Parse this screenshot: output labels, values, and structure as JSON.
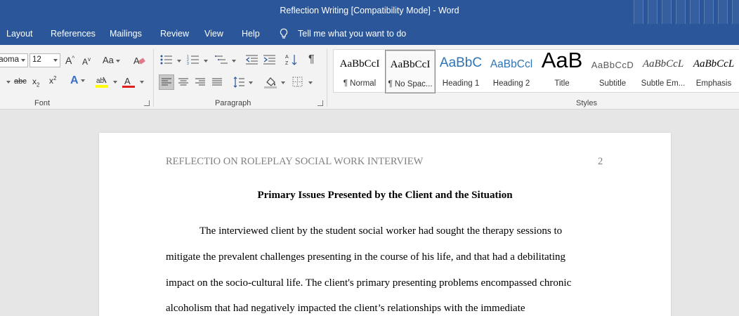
{
  "window": {
    "title": "Reflection Writing [Compatibility Mode]  -  Word"
  },
  "menu": {
    "items": [
      "Layout",
      "References",
      "Mailings",
      "Review",
      "View",
      "Help"
    ],
    "tell_me": "Tell me what you want to do"
  },
  "ribbon": {
    "font": {
      "group_label": "Font",
      "name": "Taoma",
      "size": "12",
      "case_label": "Aa",
      "strike_label": "abc"
    },
    "paragraph": {
      "group_label": "Paragraph"
    },
    "styles": {
      "group_label": "Styles",
      "items": [
        {
          "sample": "AaBbCcI",
          "name": "¶ Normal"
        },
        {
          "sample": "AaBbCcI",
          "name": "¶ No Spac..."
        },
        {
          "sample": "AaBbC",
          "name": "Heading 1"
        },
        {
          "sample": "AaBbCcl",
          "name": "Heading 2"
        },
        {
          "sample": "AaB",
          "name": "Title"
        },
        {
          "sample": "AaBbCcD",
          "name": "Subtitle"
        },
        {
          "sample": "AaBbCcL",
          "name": "Subtle Em..."
        },
        {
          "sample": "AaBbCcL",
          "name": "Emphasis"
        }
      ],
      "selected_index": 1
    }
  },
  "document": {
    "running_head": "REFLECTIO ON ROLEPLAY SOCIAL WORK INTERVIEW",
    "page_number": "2",
    "heading": "Primary Issues Presented by the Client and the Situation",
    "lines": [
      "The interviewed client by the student social worker had sought the therapy sessions to",
      "mitigate the prevalent challenges presenting in the course of his life, and that had a debilitating",
      "impact on the socio-cultural life. The client's primary presenting problems encompassed chronic",
      "alcoholism that had negatively impacted the client’s relationships with the immediate"
    ]
  },
  "colors": {
    "title_bar": "#2b579a",
    "ribbon_bg": "#f3f3f3",
    "workspace": "#e6e6e6",
    "heading1_blue": "#2e74b5",
    "heading2_blue": "#2e74b5"
  }
}
